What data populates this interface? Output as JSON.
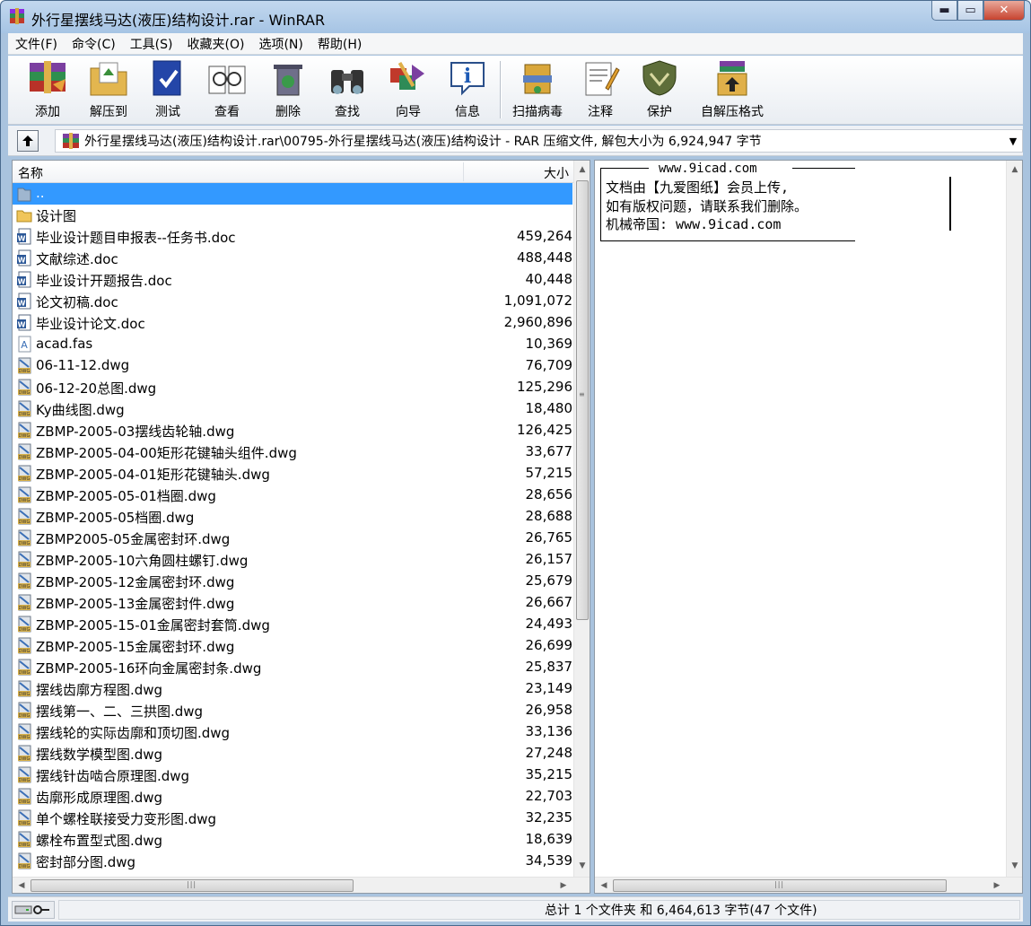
{
  "window": {
    "title": "外行星摆线马达(液压)结构设计.rar - WinRAR",
    "minimize_label": "▬",
    "maximize_label": "▭",
    "close_label": "✕"
  },
  "menu": [
    "文件(F)",
    "命令(C)",
    "工具(S)",
    "收藏夹(O)",
    "选项(N)",
    "帮助(H)"
  ],
  "toolbar": {
    "add": "添加",
    "extract": "解压到",
    "test": "测试",
    "view": "查看",
    "delete": "删除",
    "find": "查找",
    "wizard": "向导",
    "info": "信息",
    "virus_scan": "扫描病毒",
    "comment": "注释",
    "protect": "保护",
    "sfx": "自解压格式"
  },
  "address": {
    "path": "外行星摆线马达(液压)结构设计.rar\\00795-外行星摆线马达(液压)结构设计 - RAR 压缩文件, 解包大小为 6,924,947 字节"
  },
  "columns": {
    "name": "名称",
    "size": "大小"
  },
  "files": [
    {
      "name": "..",
      "size": "",
      "type": "parent"
    },
    {
      "name": "设计图",
      "size": "",
      "type": "folder"
    },
    {
      "name": "毕业设计题目申报表--任务书.doc",
      "size": "459,264",
      "type": "doc"
    },
    {
      "name": "文献综述.doc",
      "size": "488,448",
      "type": "doc"
    },
    {
      "name": "毕业设计开题报告.doc",
      "size": "40,448",
      "type": "doc"
    },
    {
      "name": "论文初稿.doc",
      "size": "1,091,072",
      "type": "doc"
    },
    {
      "name": "毕业设计论文.doc",
      "size": "2,960,896",
      "type": "doc"
    },
    {
      "name": "acad.fas",
      "size": "10,369",
      "type": "fas"
    },
    {
      "name": "06-11-12.dwg",
      "size": "76,709",
      "type": "dwg"
    },
    {
      "name": "06-12-20总图.dwg",
      "size": "125,296",
      "type": "dwg"
    },
    {
      "name": "Ky曲线图.dwg",
      "size": "18,480",
      "type": "dwg"
    },
    {
      "name": "ZBMP-2005-03摆线齿轮轴.dwg",
      "size": "126,425",
      "type": "dwg"
    },
    {
      "name": "ZBMP-2005-04-00矩形花键轴头组件.dwg",
      "size": "33,677",
      "type": "dwg"
    },
    {
      "name": "ZBMP-2005-04-01矩形花键轴头.dwg",
      "size": "57,215",
      "type": "dwg"
    },
    {
      "name": "ZBMP-2005-05-01档圈.dwg",
      "size": "28,656",
      "type": "dwg"
    },
    {
      "name": "ZBMP-2005-05档圈.dwg",
      "size": "28,688",
      "type": "dwg"
    },
    {
      "name": "ZBMP2005-05金属密封环.dwg",
      "size": "26,765",
      "type": "dwg"
    },
    {
      "name": "ZBMP-2005-10六角圆柱螺钉.dwg",
      "size": "26,157",
      "type": "dwg"
    },
    {
      "name": "ZBMP-2005-12金属密封环.dwg",
      "size": "25,679",
      "type": "dwg"
    },
    {
      "name": "ZBMP-2005-13金属密封件.dwg",
      "size": "26,667",
      "type": "dwg"
    },
    {
      "name": "ZBMP-2005-15-01金属密封套筒.dwg",
      "size": "24,493",
      "type": "dwg"
    },
    {
      "name": "ZBMP-2005-15金属密封环.dwg",
      "size": "26,699",
      "type": "dwg"
    },
    {
      "name": "ZBMP-2005-16环向金属密封条.dwg",
      "size": "25,837",
      "type": "dwg"
    },
    {
      "name": "摆线齿廓方程图.dwg",
      "size": "23,149",
      "type": "dwg"
    },
    {
      "name": "摆线第一、二、三拱图.dwg",
      "size": "26,958",
      "type": "dwg"
    },
    {
      "name": "摆线轮的实际齿廓和顶切图.dwg",
      "size": "33,136",
      "type": "dwg"
    },
    {
      "name": "摆线数学模型图.dwg",
      "size": "27,248",
      "type": "dwg"
    },
    {
      "name": "摆线针齿啮合原理图.dwg",
      "size": "35,215",
      "type": "dwg"
    },
    {
      "name": "齿廓形成原理图.dwg",
      "size": "22,703",
      "type": "dwg"
    },
    {
      "name": "单个螺栓联接受力变形图.dwg",
      "size": "32,235",
      "type": "dwg"
    },
    {
      "name": "螺栓布置型式图.dwg",
      "size": "18,639",
      "type": "dwg"
    },
    {
      "name": "密封部分图.dwg",
      "size": "34,539",
      "type": "dwg"
    }
  ],
  "comment": {
    "header": "www.9icad.com",
    "line1": "文档由【九爱图纸】会员上传,",
    "line2": "如有版权问题，请联系我们删除。",
    "line3": "机械帝国: www.9icad.com"
  },
  "status": {
    "summary": "总计 1 个文件夹 和 6,464,613 字节(47 个文件)"
  }
}
